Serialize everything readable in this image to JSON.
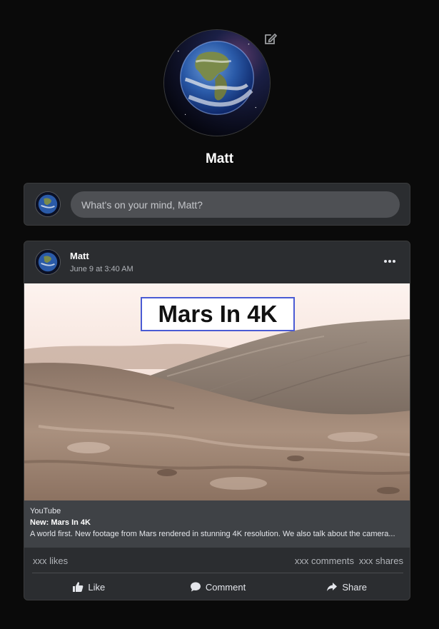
{
  "profile": {
    "name": "Matt",
    "avatar_icon": "earth-globe",
    "edit_icon": "pencil-edit-icon"
  },
  "composer": {
    "placeholder": "What's on your mind, Matt?"
  },
  "post": {
    "author": "Matt",
    "timestamp": "June 9 at 3:40 AM",
    "menu_icon": "more-horizontal-icon",
    "media": {
      "overlay_title": "Mars In 4K",
      "scene": "mars-dune-landscape"
    },
    "link": {
      "source": "YouTube",
      "title": "New: Mars In 4K",
      "description": "A world first. New footage from Mars rendered in stunning 4K resolution. We also talk about the camera..."
    },
    "stats": {
      "likes": "xxx likes",
      "comments": "xxx comments",
      "shares": "xxx shares"
    },
    "actions": [
      {
        "label": "Like",
        "icon": "thumbs-up-icon"
      },
      {
        "label": "Comment",
        "icon": "comment-bubble-icon"
      },
      {
        "label": "Share",
        "icon": "share-arrow-icon"
      }
    ]
  },
  "colors": {
    "background": "#0a0a0a",
    "card": "#2b2d30",
    "input": "#4e5054",
    "link_preview": "#3f4246",
    "title_border": "#4a5bd4"
  }
}
